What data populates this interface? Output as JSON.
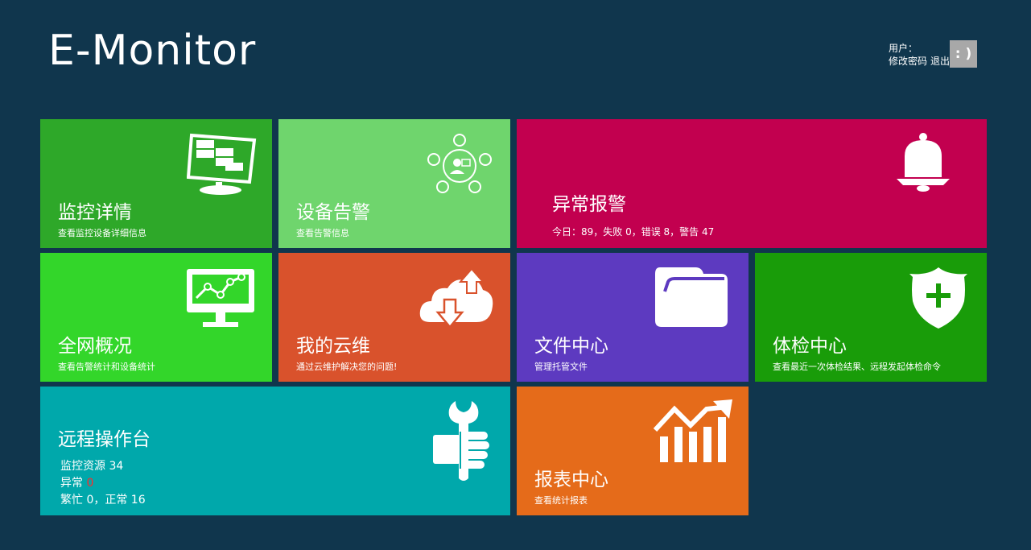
{
  "header": {
    "logo": "E-Monitor",
    "user_label": "用户：",
    "change_password": "修改密码",
    "logout": "退出",
    "avatar_text": ": )"
  },
  "tiles": {
    "monitor_detail": {
      "title": "监控详情",
      "subtitle": "查看监控设备详细信息",
      "color": "#2ea829",
      "icon": "monitor-servers-icon"
    },
    "device_alarm": {
      "title": "设备告警",
      "subtitle": "查看告警信息",
      "color": "#6fd56d",
      "icon": "network-user-icon"
    },
    "abnormal_alarm": {
      "title": "异常报警",
      "subtitle": "今日：89，失败 0，错误 8，警告 47",
      "color": "#c2004f",
      "icon": "bell-icon"
    },
    "network_overview": {
      "title": "全网概况",
      "subtitle": "查看告警统计和设备统计",
      "color": "#33d62a",
      "icon": "monitor-chart-icon"
    },
    "my_cloud": {
      "title": "我的云维",
      "subtitle": "通过云维护解决您的问题!",
      "color": "#d9522c",
      "icon": "cloud-sync-icon"
    },
    "file_center": {
      "title": "文件中心",
      "subtitle": "管理托管文件",
      "color": "#5d3ac0",
      "icon": "folder-icon"
    },
    "health_center": {
      "title": "体检中心",
      "subtitle": "查看最近一次体检结果、远程发起体检命令",
      "color": "#199c09",
      "icon": "shield-plus-icon"
    },
    "remote_console": {
      "title": "远程操作台",
      "color": "#00a8ab",
      "icon": "wrench-hand-icon",
      "stat_resources": "监控资源 34",
      "stat_abnormal_label": "异常",
      "stat_abnormal_value": "0",
      "stat_busy": "繁忙 0，正常 16"
    },
    "report_center": {
      "title": "报表中心",
      "subtitle": "查看统计报表",
      "color": "#e56b1a",
      "icon": "bar-chart-up-icon"
    }
  }
}
